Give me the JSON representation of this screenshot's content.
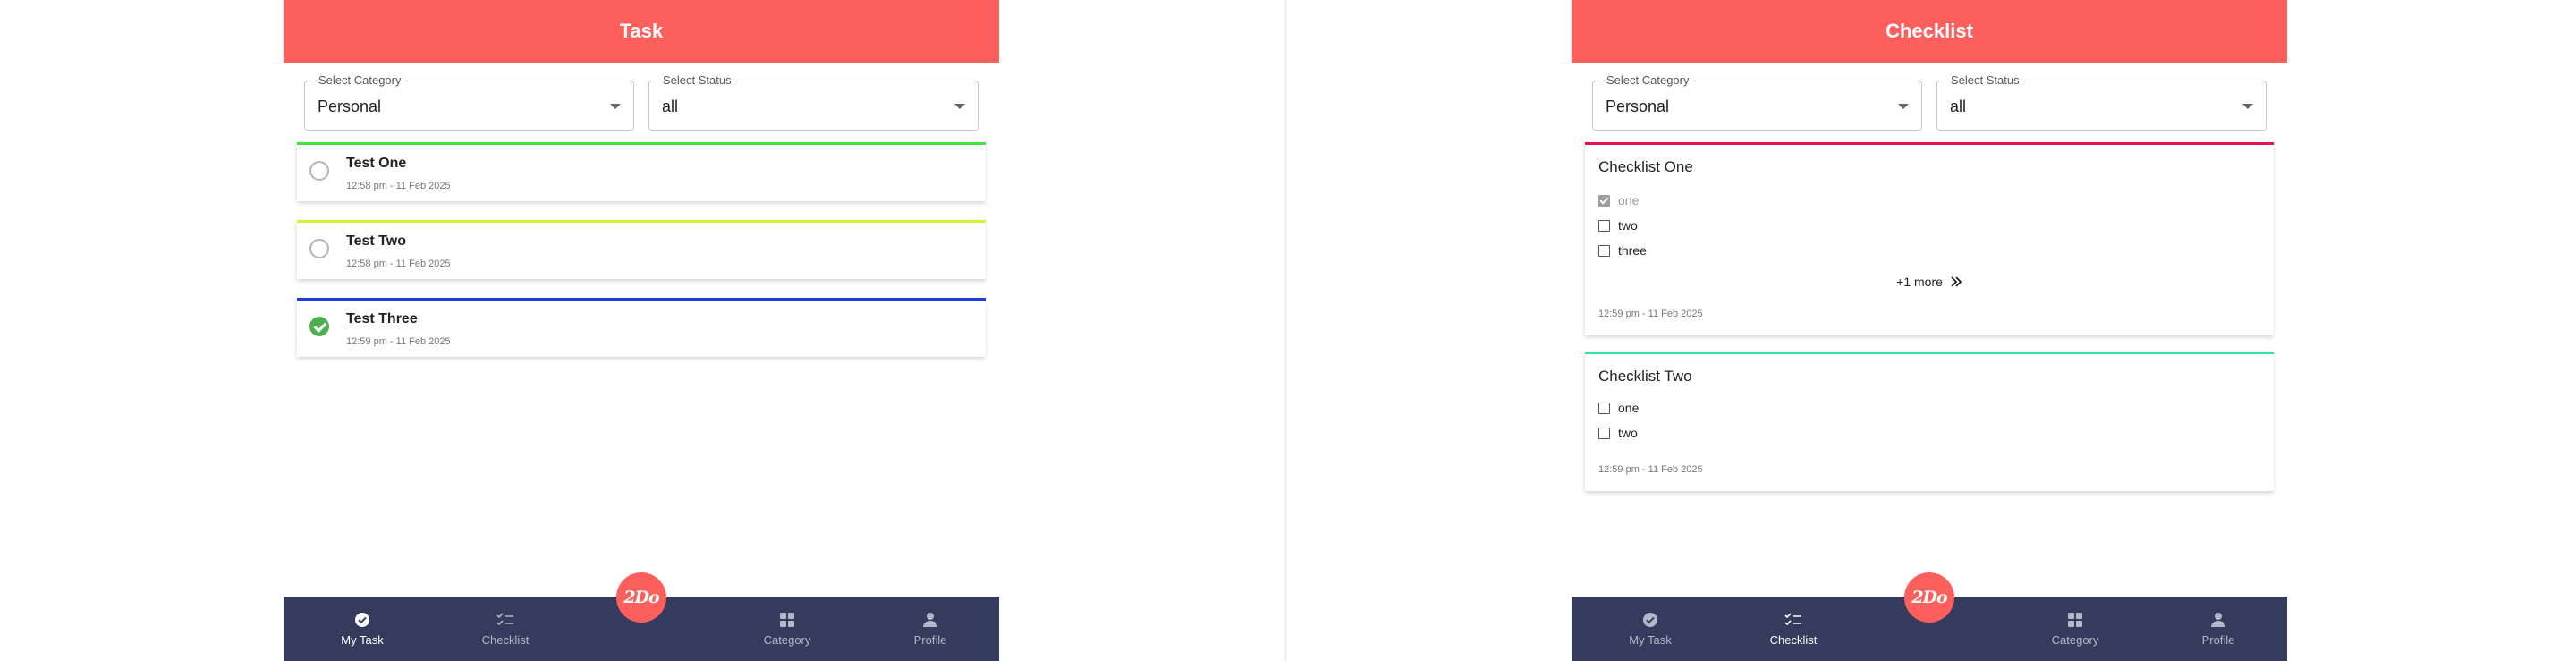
{
  "task_screen": {
    "title": "Task",
    "category_select": {
      "label": "Select Category",
      "value": "Personal"
    },
    "status_select": {
      "label": "Select Status",
      "value": "all"
    },
    "tasks": [
      {
        "title": "Test One",
        "time": "12:58 pm - 11 Feb 2025",
        "color": "#3ce63c",
        "completed": false
      },
      {
        "title": "Test Two",
        "time": "12:58 pm - 11 Feb 2025",
        "color": "#d4f23a",
        "completed": false
      },
      {
        "title": "Test Three",
        "time": "12:59 pm - 11 Feb 2025",
        "color": "#1f3fd6",
        "completed": true
      }
    ],
    "active_tab": "my_task"
  },
  "checklist_screen": {
    "title": "Checklist",
    "category_select": {
      "label": "Select Category",
      "value": "Personal"
    },
    "status_select": {
      "label": "Select Status",
      "value": "all"
    },
    "checklists": [
      {
        "title": "Checklist One",
        "color": "#e8124f",
        "items": [
          {
            "label": "one",
            "checked": true
          },
          {
            "label": "two",
            "checked": false
          },
          {
            "label": "three",
            "checked": false
          }
        ],
        "more_label": "+1 more",
        "time": "12:59 pm - 11 Feb 2025"
      },
      {
        "title": "Checklist Two",
        "color": "#2de8a0",
        "items": [
          {
            "label": "one",
            "checked": false
          },
          {
            "label": "two",
            "checked": false
          }
        ],
        "time": "12:59 pm - 11 Feb 2025"
      }
    ],
    "active_tab": "checklist"
  },
  "nav": {
    "my_task": "My Task",
    "checklist": "Checklist",
    "category": "Category",
    "profile": "Profile",
    "fab_label": "2Do"
  },
  "colors": {
    "header": "#fd5f5c",
    "nav_bg": "#343b5c",
    "fab": "#fd5f5c",
    "complete": "#4caf50"
  }
}
